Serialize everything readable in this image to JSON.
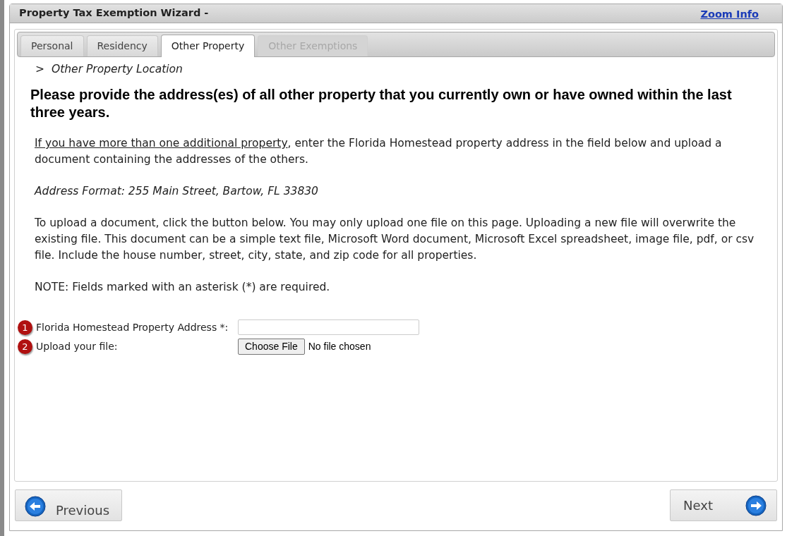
{
  "window": {
    "title": "Property Tax Exemption Wizard -",
    "zoom_link": "Zoom Info"
  },
  "tabs": [
    {
      "label": "Personal",
      "selected": false,
      "disabled": false
    },
    {
      "label": "Residency",
      "selected": false,
      "disabled": false
    },
    {
      "label": "Other Property",
      "selected": true,
      "disabled": false
    },
    {
      "label": "Other Exemptions",
      "selected": false,
      "disabled": true
    }
  ],
  "breadcrumb": {
    "marker": ">",
    "text": "Other Property Location"
  },
  "heading": "Please provide the address(es) of all other property that you currently own or have owned within the last three years.",
  "paragraphs": [
    {
      "kind": "lead",
      "underlined": "If you have more than one additional property",
      "text": ", enter the Florida Homestead property address in the field below and upload a document containing the addresses of the others."
    },
    {
      "kind": "italic",
      "text": "Address Format: 255 Main Street, Bartow, FL 33830"
    },
    {
      "kind": "plain",
      "text": "To upload a document, click the button below. You may only upload one file on this page. Uploading a new file will overwrite the existing file. This document can be a simple text file, Microsoft Word document, Microsoft Excel spreadsheet, image file, pdf, or csv file. Include the house number, street, city, state, and zip code for all properties."
    },
    {
      "kind": "plain",
      "text": "NOTE: Fields marked with an asterisk (*) are required."
    }
  ],
  "fields": [
    {
      "kind": "text",
      "badge": "1",
      "label": "Florida Homestead Property Address *:"
    },
    {
      "kind": "file",
      "badge": "2",
      "label": "Upload your file:",
      "button": "Choose File",
      "status": "No file chosen"
    }
  ],
  "nav": {
    "previous": "Previous",
    "next": "Next"
  }
}
